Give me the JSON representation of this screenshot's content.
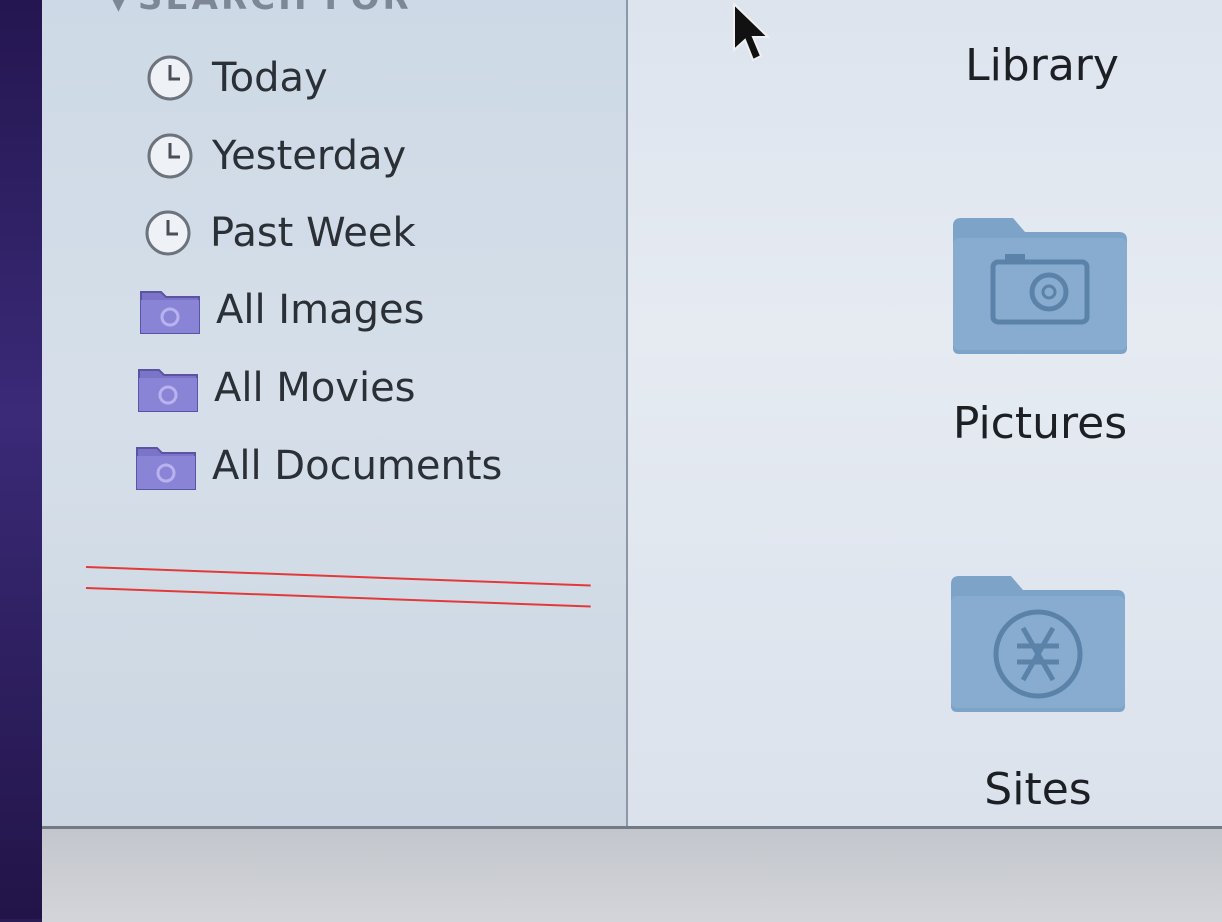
{
  "sidebar": {
    "section_header": "SEARCH FOR",
    "items": [
      {
        "label": "Today",
        "icon": "clock-icon"
      },
      {
        "label": "Yesterday",
        "icon": "clock-icon"
      },
      {
        "label": "Past Week",
        "icon": "clock-icon"
      },
      {
        "label": "All Images",
        "icon": "smart-folder-icon"
      },
      {
        "label": "All Movies",
        "icon": "smart-folder-icon"
      },
      {
        "label": "All Documents",
        "icon": "smart-folder-icon"
      }
    ]
  },
  "content": {
    "items": [
      {
        "label": "Library",
        "icon": "library-folder-icon"
      },
      {
        "label": "Pictures",
        "icon": "pictures-folder-icon"
      },
      {
        "label": "Sites",
        "icon": "sites-folder-icon"
      }
    ]
  },
  "colors": {
    "annotation_line": "#e23a3a",
    "folder_blue": "#7ea3c8"
  }
}
